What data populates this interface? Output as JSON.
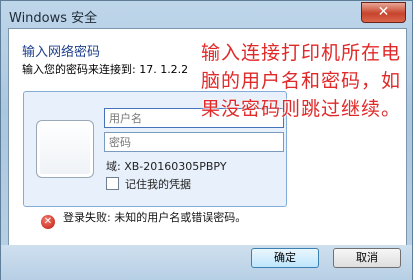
{
  "window": {
    "title": "Windows 安全",
    "close_glyph": "✕"
  },
  "dialog": {
    "heading": "输入网络密码",
    "description": "输入您的密码来连接到: 17.   1.2.2"
  },
  "credentials": {
    "username_placeholder": "用户名",
    "password_placeholder": "密码",
    "domain": "域: XB-20160305PBPY",
    "remember_label": "记住我的凭据",
    "remember_checked": false
  },
  "error": {
    "message": "登录失败: 未知的用户名或错误密码。",
    "icon": "error-icon"
  },
  "annotation": {
    "text": "输入连接打印机所在电脑的用户名和密码，如果没密码则跳过继续。",
    "color": "#e02a2a"
  },
  "buttons": {
    "ok_label": "确定",
    "cancel_label": "取消"
  }
}
